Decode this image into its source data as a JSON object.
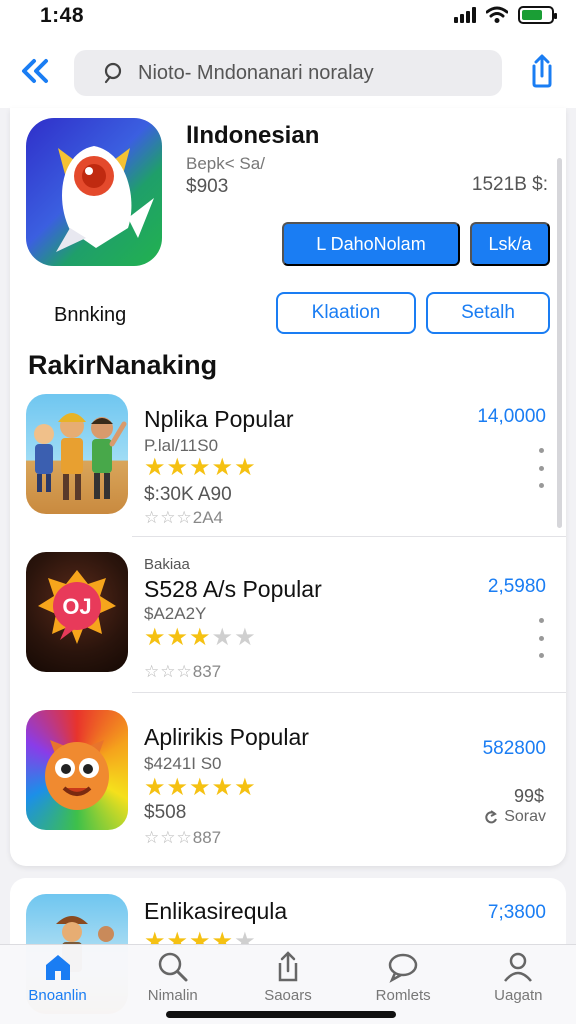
{
  "status": {
    "time": "1:48",
    "battery_level": 0.7
  },
  "nav": {
    "search_value": "Nioto- Mndonanari noralay"
  },
  "app": {
    "title": "lIndonesian",
    "subtitle": "Bepk< Sa/",
    "price": "$903",
    "size": "1521B $:",
    "download_label": "L DahoNolam",
    "list_label": "Lsk/a"
  },
  "filters": {
    "category": "Bnnking",
    "filter_a": "Klaation",
    "filter_b": "Setalh"
  },
  "section_title": "RakirNanaking",
  "rows": [
    {
      "title": "Nplika Popular",
      "sub": "P.lal/11S0",
      "stars_filled": 5,
      "stars_total": 5,
      "price": "$:30K A90",
      "rating_text": "2A4",
      "count": "14,0000"
    },
    {
      "overline": "Bakiaa",
      "title": "S528 A/s Popular",
      "sub": "$A2A2Y",
      "stars_filled": 3,
      "stars_total": 5,
      "price": "",
      "rating_text": "837",
      "count": "2,5980",
      "icon_text": "OJ"
    },
    {
      "title": "Aplirikis Popular",
      "sub": "$4241I S0",
      "stars_filled": 5,
      "stars_total": 5,
      "price": "$508",
      "rating_text": "887",
      "count": "582800",
      "extra_price": "99$",
      "extra_label": "Sorav"
    },
    {
      "title": "Enlikasirequla",
      "count": "7;3800",
      "stars_filled": 4,
      "stars_total": 5
    }
  ],
  "tabs": [
    {
      "label": "Bnoanlin",
      "icon": "home-icon",
      "active": true
    },
    {
      "label": "Nimalin",
      "icon": "search-icon",
      "active": false
    },
    {
      "label": "Saoars",
      "icon": "share-icon",
      "active": false
    },
    {
      "label": "Romlets",
      "icon": "chat-icon",
      "active": false
    },
    {
      "label": "Uagatn",
      "icon": "person-icon",
      "active": false
    }
  ],
  "colors": {
    "accent": "#1a7df3",
    "star": "#f5c112"
  }
}
